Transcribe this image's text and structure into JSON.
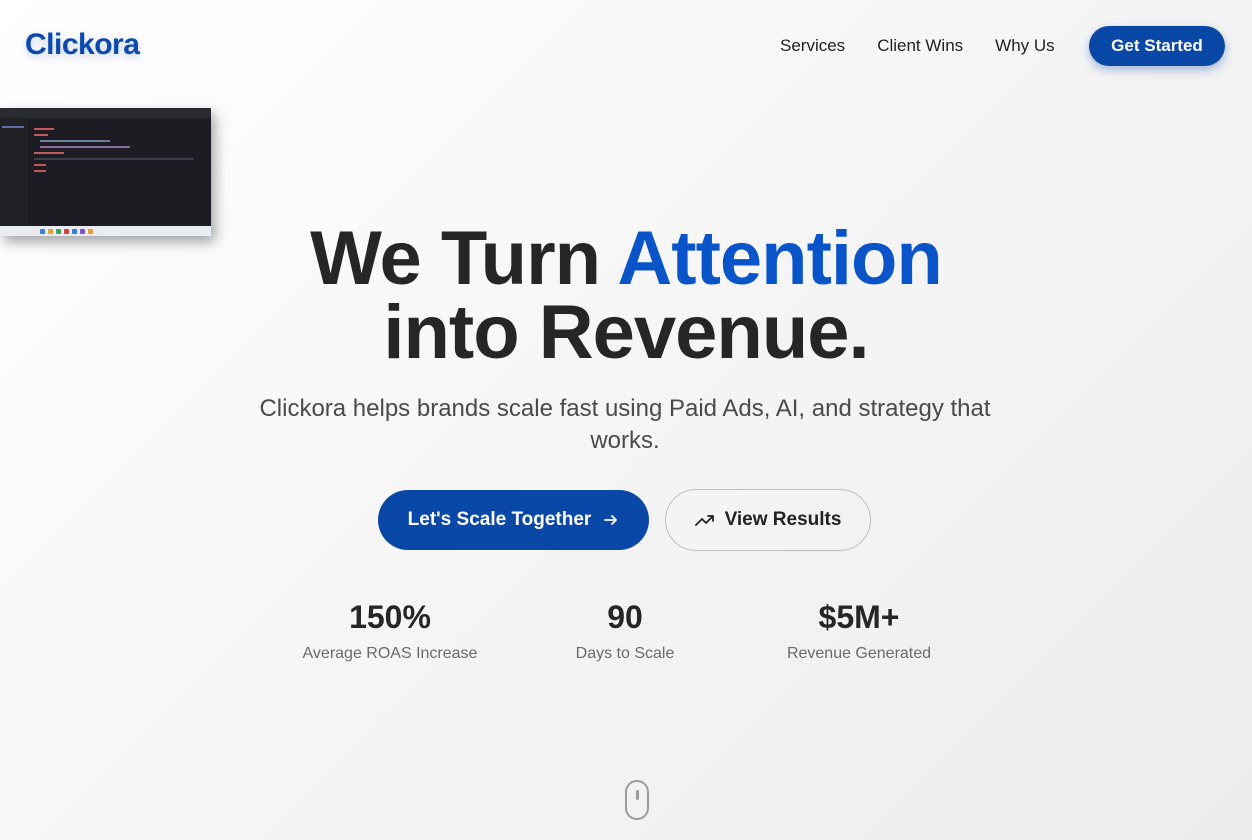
{
  "nav": {
    "logo": "Clickora",
    "links": [
      "Services",
      "Client Wins",
      "Why Us"
    ],
    "cta": "Get Started"
  },
  "hero": {
    "title_part1": "We Turn ",
    "title_accent": "Attention",
    "title_part2": "into Revenue.",
    "subtitle": "Clickora helps brands scale fast using Paid Ads, AI, and strategy that works.",
    "primary_button": "Let's Scale Together",
    "secondary_button": "View Results"
  },
  "stats": [
    {
      "value": "150%",
      "label": "Average ROAS Increase"
    },
    {
      "value": "90",
      "label": "Days to Scale"
    },
    {
      "value": "$5M+",
      "label": "Revenue Generated"
    }
  ],
  "colors": {
    "brand": "#0a48a8",
    "accent": "#0a54c9",
    "text": "#262626"
  },
  "icons": {
    "primary_button": "arrow-right-icon",
    "secondary_button": "trending-up-icon",
    "scroll_indicator": "mouse-scroll-icon"
  }
}
